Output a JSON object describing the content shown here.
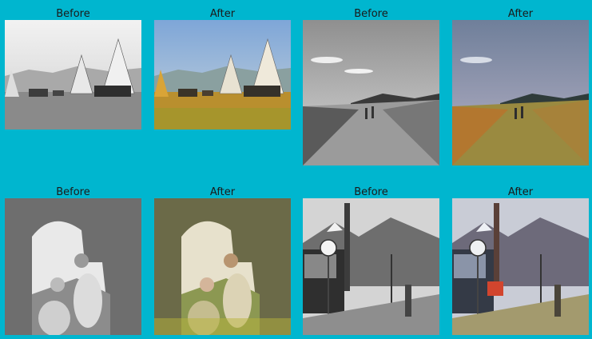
{
  "pairs": [
    {
      "before_label": "Before",
      "after_label": "After",
      "subject": "teepee camp with horses"
    },
    {
      "before_label": "Before",
      "after_label": "After",
      "subject": "two people walking on meadow path"
    },
    {
      "before_label": "Before",
      "after_label": "After",
      "subject": "two girls at stone archway"
    },
    {
      "before_label": "Before",
      "after_label": "After",
      "subject": "street with bus, chimney and mountains"
    }
  ]
}
